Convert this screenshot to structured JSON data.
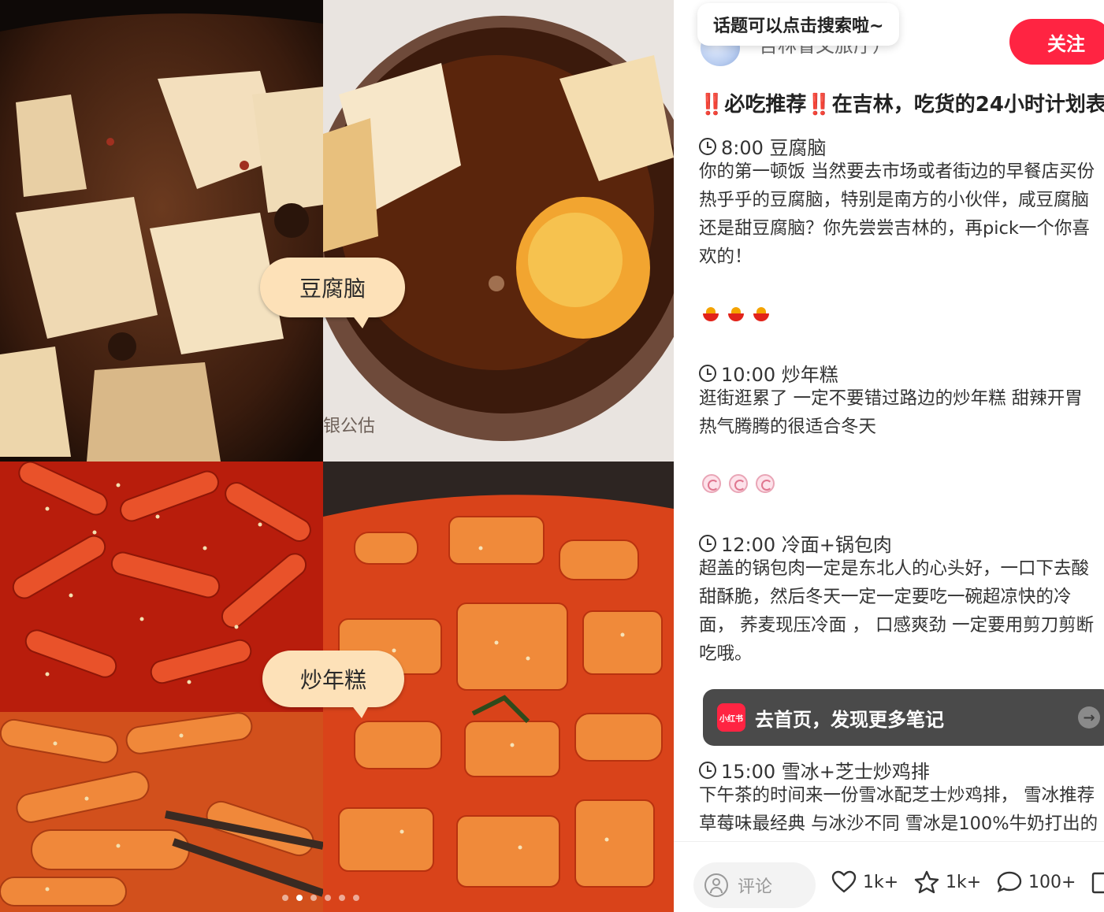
{
  "gallery": {
    "labels": [
      "豆腐脑",
      "炒年糕"
    ],
    "photo_watermark": "银公估",
    "page_count": 6,
    "active_index": 1
  },
  "author": {
    "name": "吉林省文旅厅）",
    "tooltip": "话题可以点击搜索啦~",
    "follow_label": "关注"
  },
  "note": {
    "title": "‼️必吃推荐‼️在吉林，吃货的24小时计划表",
    "sections": [
      {
        "time": "8:00 豆腐脑",
        "lines": [
          "你的第一顿饭 当然要去市场或者街边的早餐店买份",
          "热乎乎的豆腐脑，特别是南方的小伙伴，咸豆腐脑",
          "还是甜豆腐脑？你先尝尝吉林的，再pick一个你喜",
          "欢的！"
        ],
        "emoji": "hotpot-icon"
      },
      {
        "time": "10:00 炒年糕",
        "lines": [
          "逛街逛累了 一定不要错过路边的炒年糕 甜辣开胃",
          "热气腾腾的很适合冬天"
        ],
        "emoji": "fish-cake-icon"
      },
      {
        "time": "12:00 冷面+锅包肉",
        "lines": [
          "超盖的锅包肉一定是东北人的心头好，一口下去酸",
          "甜酥脆，然后冬天一定一定要吃一碗超凉快的冷",
          "面， 荞麦现压冷面 ， 口感爽劲 一定要用剪刀剪断",
          "吃哦。"
        ]
      },
      {
        "time": "15:00 雪冰+芝士炒鸡排",
        "lines": [
          "下午茶的时间来一份雪冰配芝士炒鸡排， 雪冰推荐",
          "草莓味最经典 与冰沙不同 雪冰是100%牛奶打出的"
        ]
      }
    ]
  },
  "banner": {
    "logo_text": "小红书",
    "text": "去首页，发现更多笔记"
  },
  "bottom_bar": {
    "comment_placeholder": "评论",
    "likes": "1k+",
    "collects": "1k+",
    "comments": "100+"
  }
}
